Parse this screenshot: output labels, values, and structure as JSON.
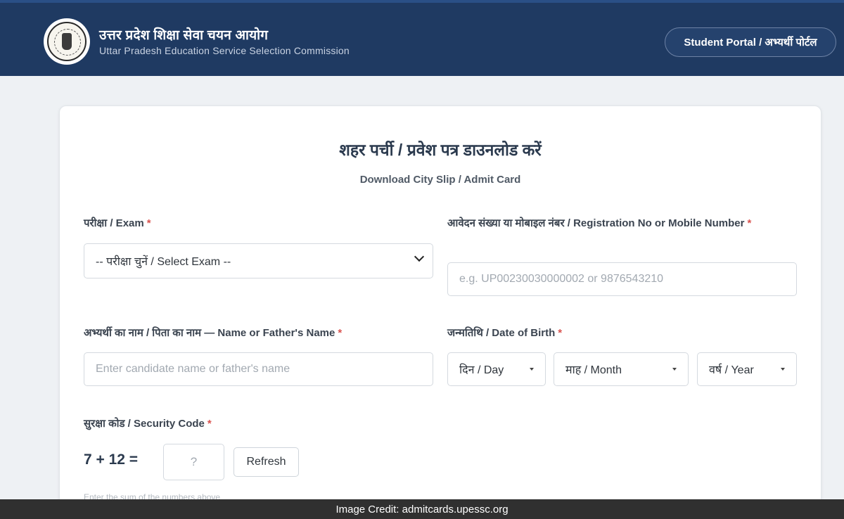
{
  "header": {
    "org_name_hi": "उत्तर प्रदेश शिक्षा सेवा चयन आयोग",
    "org_name_en": "Uttar Pradesh Education Service Selection Commission",
    "portal_button": "Student Portal / अभ्यर्थी पोर्टल",
    "logo": "state-emblem-icon"
  },
  "form": {
    "title_hi": "शहर पर्ची / प्रवेश पत्र डाउनलोड करें",
    "title_en": "Download City Slip / Admit Card",
    "exam": {
      "label": "परीक्षा / Exam",
      "required_mark": "*",
      "selected": "-- परीक्षा चुनें / Select Exam --"
    },
    "registration": {
      "label": "आवेदन संख्या या मोबाइल नंबर / Registration No or Mobile Number",
      "required_mark": "*",
      "placeholder": "e.g. UP00230030000002 or 9876543210"
    },
    "name": {
      "label": "अभ्यर्थी का नाम / पिता का नाम — Name or Father's Name",
      "required_mark": "*",
      "placeholder": "Enter candidate name or father's name"
    },
    "dob": {
      "label": "जन्मतिथि / Date of Birth",
      "required_mark": "*",
      "day": "दिन / Day",
      "month": "माह / Month",
      "year": "वर्ष / Year"
    },
    "security": {
      "label": "सुरक्षा कोड / Security Code",
      "required_mark": "*",
      "question": "7 + 12 =",
      "answer_placeholder": "?",
      "refresh_label": "Refresh",
      "hint": "Enter the sum of the numbers above"
    }
  },
  "footer": {
    "credit": "Image Credit: admitcards.upessc.org"
  },
  "colors": {
    "header_bg": "#1f3a62",
    "required": "#d9534f",
    "page_bg": "#eef1f4"
  }
}
